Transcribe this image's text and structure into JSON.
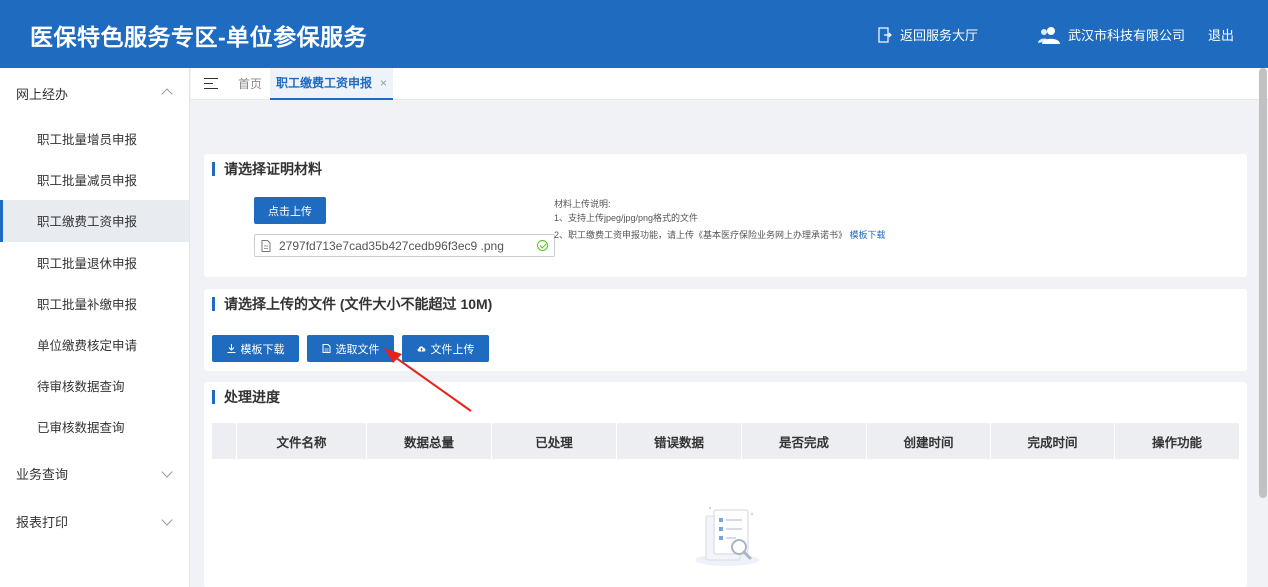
{
  "header": {
    "title": "医保特色服务专区-单位参保服务",
    "back_label": "返回服务大厅",
    "company": "武汉市科技有限公司",
    "logout": "退出"
  },
  "sidebar": {
    "groups": [
      {
        "label": "网上经办",
        "expanded": true,
        "items": [
          {
            "label": "职工批量增员申报"
          },
          {
            "label": "职工批量减员申报"
          },
          {
            "label": "职工缴费工资申报",
            "active": true
          },
          {
            "label": "职工批量退休申报"
          },
          {
            "label": "职工批量补缴申报"
          },
          {
            "label": "单位缴费核定申请"
          },
          {
            "label": "待审核数据查询"
          },
          {
            "label": "已审核数据查询"
          }
        ]
      },
      {
        "label": "业务查询",
        "expanded": false
      },
      {
        "label": "报表打印",
        "expanded": false
      }
    ]
  },
  "tabs": {
    "home": "首页",
    "active": "职工缴费工资申报",
    "close": "×"
  },
  "proof_section": {
    "title": "请选择证明材料",
    "upload_button": "点击上传",
    "file_name": "2797fd713e7cad35b427cedb96f3ec9 .png",
    "notes": {
      "heading": "材料上传说明:",
      "line1": "1、支持上传jpeg/jpg/png格式的文件",
      "line2": "2、职工缴费工资申报功能，请上传《基本医疗保险业务网上办理承诺书》",
      "link": "模板下载"
    }
  },
  "upload_section": {
    "title": "请选择上传的文件 (文件大小不能超过 10M)",
    "buttons": {
      "template": "模板下载",
      "select": "选取文件",
      "upload": "文件上传"
    }
  },
  "progress_section": {
    "title": "处理进度",
    "columns": [
      "文件名称",
      "数据总量",
      "已处理",
      "错误数据",
      "是否完成",
      "创建时间",
      "完成时间",
      "操作功能"
    ]
  },
  "colors": {
    "primary": "#1e6bc0",
    "annotation_arrow": "#e5231b"
  }
}
